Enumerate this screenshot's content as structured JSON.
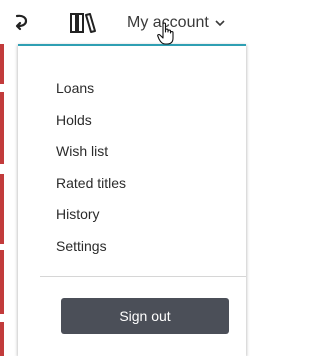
{
  "header": {
    "account_label": "My account",
    "icons": [
      "return-icon",
      "library-shelf-icon",
      "chevron-down-icon"
    ]
  },
  "dropdown": {
    "items": [
      {
        "label": "Loans"
      },
      {
        "label": "Holds"
      },
      {
        "label": "Wish list"
      },
      {
        "label": "Rated titles"
      },
      {
        "label": "History"
      },
      {
        "label": "Settings"
      }
    ],
    "sign_out_label": "Sign out"
  },
  "colors": {
    "accent_border": "#2f9fb3",
    "button_bg": "#4b4f58",
    "left_strip": "#c23b3b"
  }
}
